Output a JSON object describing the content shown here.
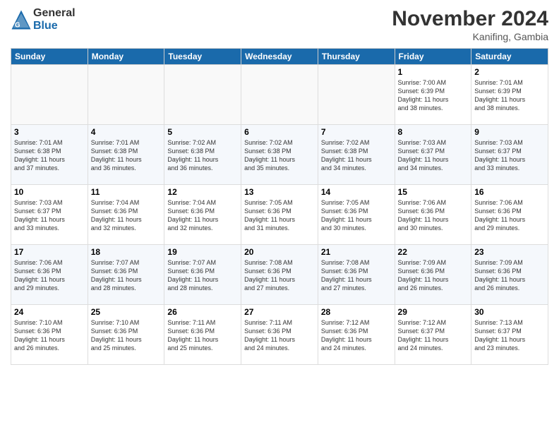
{
  "logo": {
    "general": "General",
    "blue": "Blue"
  },
  "title": "November 2024",
  "location": "Kanifing, Gambia",
  "weekdays": [
    "Sunday",
    "Monday",
    "Tuesday",
    "Wednesday",
    "Thursday",
    "Friday",
    "Saturday"
  ],
  "weeks": [
    [
      {
        "day": "",
        "info": ""
      },
      {
        "day": "",
        "info": ""
      },
      {
        "day": "",
        "info": ""
      },
      {
        "day": "",
        "info": ""
      },
      {
        "day": "",
        "info": ""
      },
      {
        "day": "1",
        "info": "Sunrise: 7:00 AM\nSunset: 6:39 PM\nDaylight: 11 hours\nand 38 minutes."
      },
      {
        "day": "2",
        "info": "Sunrise: 7:01 AM\nSunset: 6:39 PM\nDaylight: 11 hours\nand 38 minutes."
      }
    ],
    [
      {
        "day": "3",
        "info": "Sunrise: 7:01 AM\nSunset: 6:38 PM\nDaylight: 11 hours\nand 37 minutes."
      },
      {
        "day": "4",
        "info": "Sunrise: 7:01 AM\nSunset: 6:38 PM\nDaylight: 11 hours\nand 36 minutes."
      },
      {
        "day": "5",
        "info": "Sunrise: 7:02 AM\nSunset: 6:38 PM\nDaylight: 11 hours\nand 36 minutes."
      },
      {
        "day": "6",
        "info": "Sunrise: 7:02 AM\nSunset: 6:38 PM\nDaylight: 11 hours\nand 35 minutes."
      },
      {
        "day": "7",
        "info": "Sunrise: 7:02 AM\nSunset: 6:38 PM\nDaylight: 11 hours\nand 34 minutes."
      },
      {
        "day": "8",
        "info": "Sunrise: 7:03 AM\nSunset: 6:37 PM\nDaylight: 11 hours\nand 34 minutes."
      },
      {
        "day": "9",
        "info": "Sunrise: 7:03 AM\nSunset: 6:37 PM\nDaylight: 11 hours\nand 33 minutes."
      }
    ],
    [
      {
        "day": "10",
        "info": "Sunrise: 7:03 AM\nSunset: 6:37 PM\nDaylight: 11 hours\nand 33 minutes."
      },
      {
        "day": "11",
        "info": "Sunrise: 7:04 AM\nSunset: 6:36 PM\nDaylight: 11 hours\nand 32 minutes."
      },
      {
        "day": "12",
        "info": "Sunrise: 7:04 AM\nSunset: 6:36 PM\nDaylight: 11 hours\nand 32 minutes."
      },
      {
        "day": "13",
        "info": "Sunrise: 7:05 AM\nSunset: 6:36 PM\nDaylight: 11 hours\nand 31 minutes."
      },
      {
        "day": "14",
        "info": "Sunrise: 7:05 AM\nSunset: 6:36 PM\nDaylight: 11 hours\nand 30 minutes."
      },
      {
        "day": "15",
        "info": "Sunrise: 7:06 AM\nSunset: 6:36 PM\nDaylight: 11 hours\nand 30 minutes."
      },
      {
        "day": "16",
        "info": "Sunrise: 7:06 AM\nSunset: 6:36 PM\nDaylight: 11 hours\nand 29 minutes."
      }
    ],
    [
      {
        "day": "17",
        "info": "Sunrise: 7:06 AM\nSunset: 6:36 PM\nDaylight: 11 hours\nand 29 minutes."
      },
      {
        "day": "18",
        "info": "Sunrise: 7:07 AM\nSunset: 6:36 PM\nDaylight: 11 hours\nand 28 minutes."
      },
      {
        "day": "19",
        "info": "Sunrise: 7:07 AM\nSunset: 6:36 PM\nDaylight: 11 hours\nand 28 minutes."
      },
      {
        "day": "20",
        "info": "Sunrise: 7:08 AM\nSunset: 6:36 PM\nDaylight: 11 hours\nand 27 minutes."
      },
      {
        "day": "21",
        "info": "Sunrise: 7:08 AM\nSunset: 6:36 PM\nDaylight: 11 hours\nand 27 minutes."
      },
      {
        "day": "22",
        "info": "Sunrise: 7:09 AM\nSunset: 6:36 PM\nDaylight: 11 hours\nand 26 minutes."
      },
      {
        "day": "23",
        "info": "Sunrise: 7:09 AM\nSunset: 6:36 PM\nDaylight: 11 hours\nand 26 minutes."
      }
    ],
    [
      {
        "day": "24",
        "info": "Sunrise: 7:10 AM\nSunset: 6:36 PM\nDaylight: 11 hours\nand 26 minutes."
      },
      {
        "day": "25",
        "info": "Sunrise: 7:10 AM\nSunset: 6:36 PM\nDaylight: 11 hours\nand 25 minutes."
      },
      {
        "day": "26",
        "info": "Sunrise: 7:11 AM\nSunset: 6:36 PM\nDaylight: 11 hours\nand 25 minutes."
      },
      {
        "day": "27",
        "info": "Sunrise: 7:11 AM\nSunset: 6:36 PM\nDaylight: 11 hours\nand 24 minutes."
      },
      {
        "day": "28",
        "info": "Sunrise: 7:12 AM\nSunset: 6:36 PM\nDaylight: 11 hours\nand 24 minutes."
      },
      {
        "day": "29",
        "info": "Sunrise: 7:12 AM\nSunset: 6:37 PM\nDaylight: 11 hours\nand 24 minutes."
      },
      {
        "day": "30",
        "info": "Sunrise: 7:13 AM\nSunset: 6:37 PM\nDaylight: 11 hours\nand 23 minutes."
      }
    ]
  ]
}
